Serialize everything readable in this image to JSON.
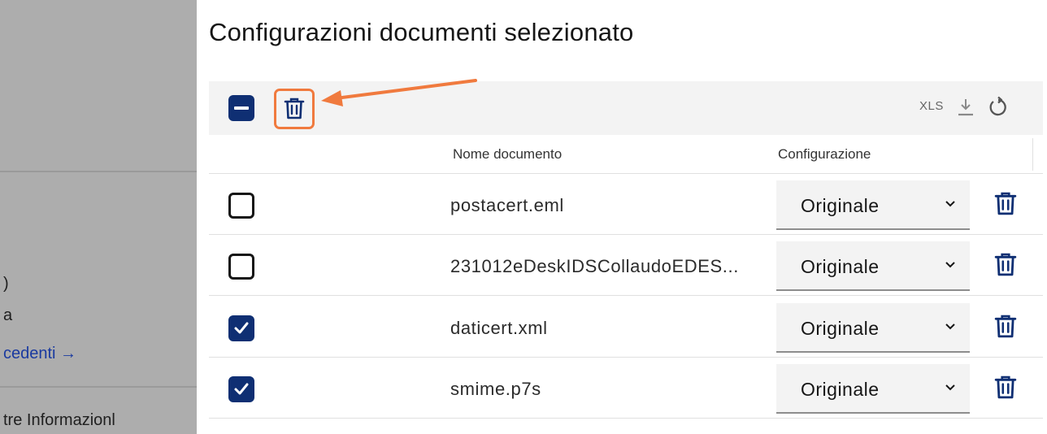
{
  "left_panel": {
    "fragments": [
      ")",
      "a",
      "cedenti →",
      "tre Informazionl"
    ]
  },
  "page": {
    "title": "Configurazioni documenti selezionato"
  },
  "toolbar": {
    "select_all_state": "indeterminate",
    "delete_icon": "trash-icon",
    "export_label": "XLS",
    "export_icon": "download-icon",
    "refresh_icon": "refresh-icon"
  },
  "table": {
    "columns": [
      "Nome documento",
      "Configurazione"
    ],
    "rows": [
      {
        "checked": false,
        "name": "postacert.eml",
        "config": "Originale"
      },
      {
        "checked": false,
        "name": "231012eDeskIDSCollaudoEDES...",
        "config": "Originale"
      },
      {
        "checked": true,
        "name": "daticert.xml",
        "config": "Originale"
      },
      {
        "checked": true,
        "name": "smime.p7s",
        "config": "Originale"
      }
    ]
  },
  "colors": {
    "primary": "#0f2f73",
    "highlight": "#f07a3e",
    "toolbar_bg": "#f3f3f3",
    "overlay_gray": "#adadad"
  }
}
